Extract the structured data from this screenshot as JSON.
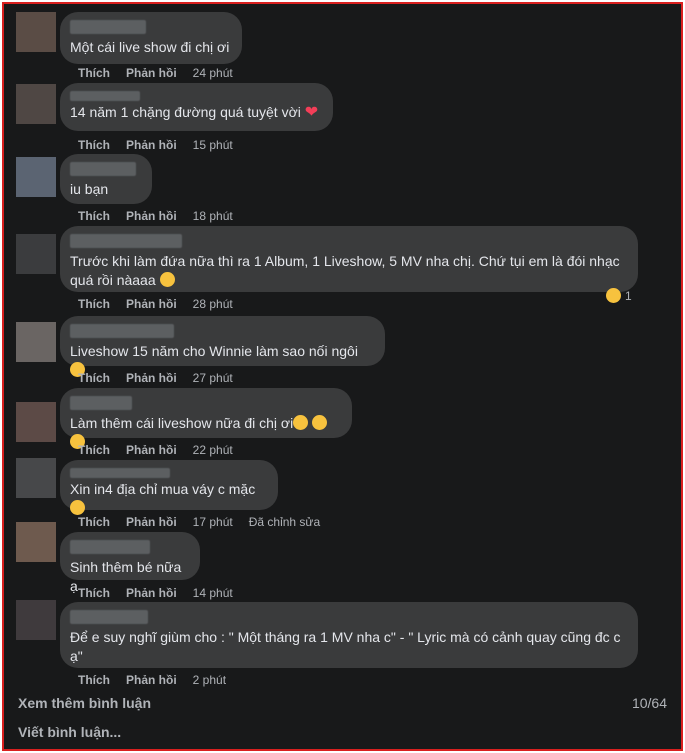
{
  "comments": [
    {
      "text": "Một cái live show đi chị ơi",
      "like": "Thích",
      "reply": "Phản hồi",
      "time": "24 phút"
    },
    {
      "text": "14 năm 1 chặng đường quá tuyệt vời",
      "like": "Thích",
      "reply": "Phản hồi",
      "time": "15 phút",
      "emoji": "heart"
    },
    {
      "text": "iu bạn",
      "like": "Thích",
      "reply": "Phản hồi",
      "time": "18 phút"
    },
    {
      "text": "Trước khi làm đứa nữa thì ra 1 Album, 1 Liveshow, 5 MV nha chị. Chứ tụi em là đói nhạc quá rồi nàaaa",
      "like": "Thích",
      "reply": "Phản hồi",
      "time": "28 phút",
      "reaction_count": "1",
      "emoji": "sad-face"
    },
    {
      "text": "Liveshow 15 năm cho Winnie làm sao nối ngôi",
      "like": "Thích",
      "reply": "Phản hồi",
      "time": "27 phút",
      "emoji": "rofl-face"
    },
    {
      "text": "Làm thêm cái liveshow nữa đi chị ơi",
      "like": "Thích",
      "reply": "Phản hồi",
      "time": "22 phút",
      "emoji": "hugging-face x3"
    },
    {
      "text": "Xin in4 địa chỉ mua váy c mặc",
      "like": "Thích",
      "reply": "Phản hồi",
      "time": "17 phút",
      "edited": "Đã chỉnh sửa",
      "emoji": "heart-eyes-face"
    },
    {
      "text": "Sinh thêm bé nữa ạ",
      "like": "Thích",
      "reply": "Phản hồi",
      "time": "14 phút"
    },
    {
      "text": "Để e suy nghĩ giùm cho : \" Một tháng ra 1 MV nha c\" - \" Lyric mà có cảnh quay cũng đc c ạ\"",
      "like": "Thích",
      "reply": "Phản hồi",
      "time": "2 phút"
    }
  ],
  "footer": {
    "more_comments": "Xem thêm bình luận",
    "count": "10/64",
    "write_comment": "Viết bình luận..."
  },
  "colors": {
    "background": "#18191a",
    "bubble": "#3a3b3c",
    "text": "#e4e6eb",
    "muted": "#b0b3b8",
    "border": "#d9201f"
  }
}
